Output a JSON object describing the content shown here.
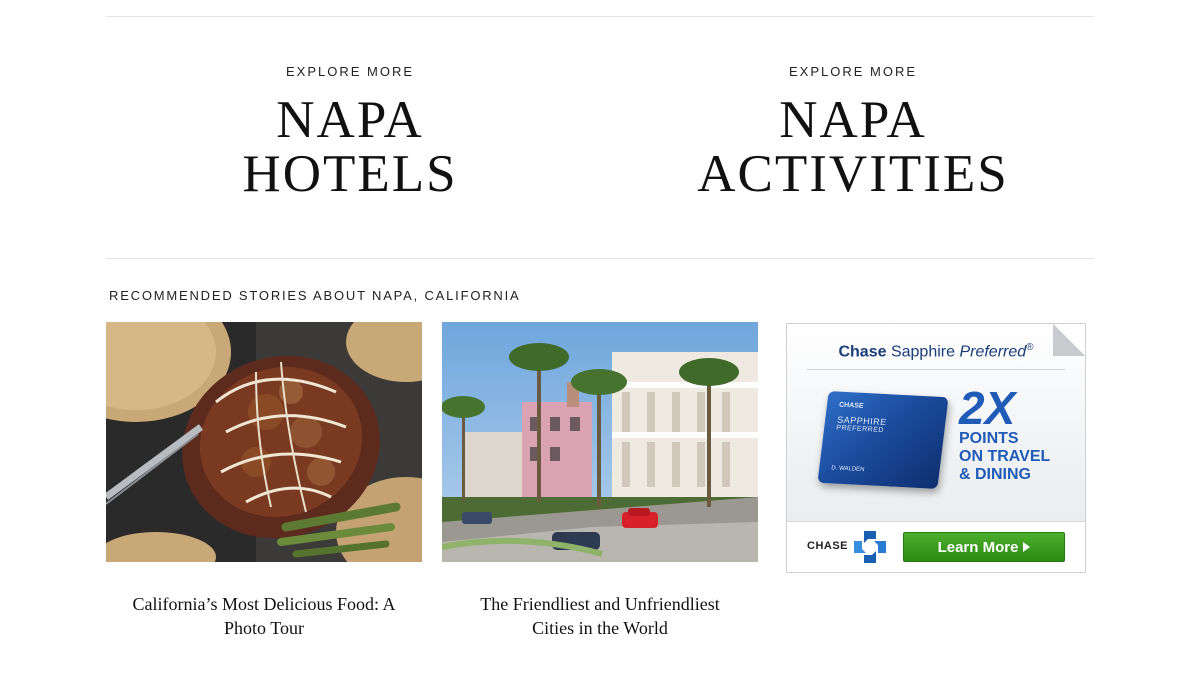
{
  "explore": [
    {
      "eyebrow": "EXPLORE MORE",
      "line1": "NAPA",
      "line2": "HOTELS"
    },
    {
      "eyebrow": "EXPLORE MORE",
      "line1": "NAPA",
      "line2": "ACTIVITIES"
    }
  ],
  "recommended": {
    "title": "RECOMMENDED STORIES ABOUT NAPA, CALIFORNIA",
    "stories": [
      {
        "caption": "California’s Most Delicious Food: A Photo Tour",
        "image": "tostada-photo"
      },
      {
        "caption": "The Friendliest and Unfriendliest Cities in the World",
        "image": "street-photo"
      }
    ]
  },
  "ad": {
    "brand": "Chase",
    "product": "Sapphire",
    "product_italic": "Preferred",
    "registered": "®",
    "card_bank": "CHASE",
    "card_name": "SAPPHIRE",
    "card_sub": "PREFERRED",
    "card_holder": "D. WALDEN",
    "multiplier": "2X",
    "offer_line1": "POINTS",
    "offer_line2": "ON TRAVEL",
    "offer_line3": "& DINING",
    "footer_brand": "CHASE",
    "cta": "Learn More",
    "colors": {
      "chase_blue": "#1f5bb7",
      "cta_green": "#3a9c1f"
    }
  }
}
